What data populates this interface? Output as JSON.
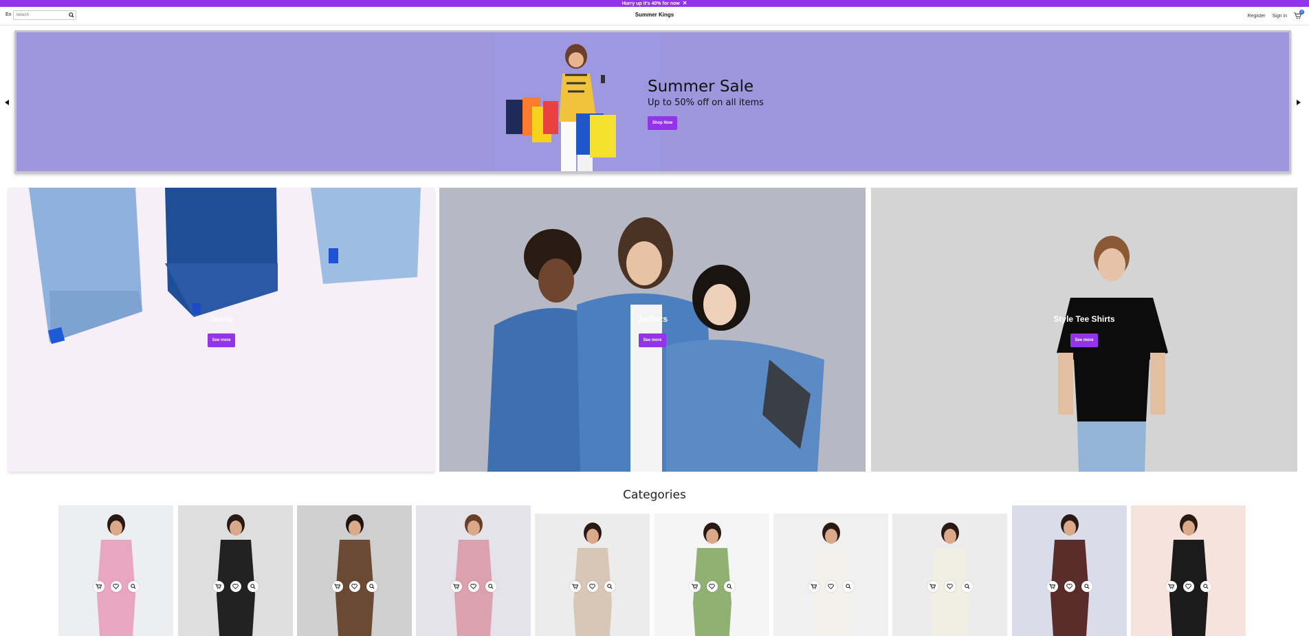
{
  "announcement": {
    "text": "Hurry up it's 40% for now",
    "close_icon": "close-icon"
  },
  "header": {
    "language": "En",
    "search_placeholder": "Search",
    "brand": "Summer Kings",
    "register": "Register",
    "sign_in": "Sign in",
    "cart_count": "0"
  },
  "hero": {
    "title": "Summer Sale",
    "subtitle": "Up to 50% off on all items",
    "button": "Shop Now",
    "background": "#9f97de"
  },
  "promos": [
    {
      "label": "Jeans",
      "button": "See more"
    },
    {
      "label": "Jackets",
      "button": "See more"
    },
    {
      "label": "Style Tee Shirts",
      "button": "See more"
    }
  ],
  "categories": {
    "title": "Categories",
    "products": [
      {
        "name": "floral-mini-dress",
        "bg": "#eceef1"
      },
      {
        "name": "printed-maxi-dress",
        "bg": "#dedede"
      },
      {
        "name": "chevron-jumpsuit",
        "bg": "#cfcfcf"
      },
      {
        "name": "pink-check-blouse",
        "bg": "#e5e3ea"
      },
      {
        "name": "beige-hoodie-set",
        "bg": "#ececec"
      },
      {
        "name": "green-tee",
        "bg": "#f5f5f5"
      },
      {
        "name": "white-shirt",
        "bg": "#f0f0f0"
      },
      {
        "name": "cream-sweater",
        "bg": "#ececec"
      },
      {
        "name": "ruffle-top-pants",
        "bg": "#dadcea"
      },
      {
        "name": "black-cami-set",
        "bg": "#f6e3dd"
      }
    ]
  },
  "colors": {
    "accent": "#9333ea",
    "badge": "#2563eb"
  }
}
